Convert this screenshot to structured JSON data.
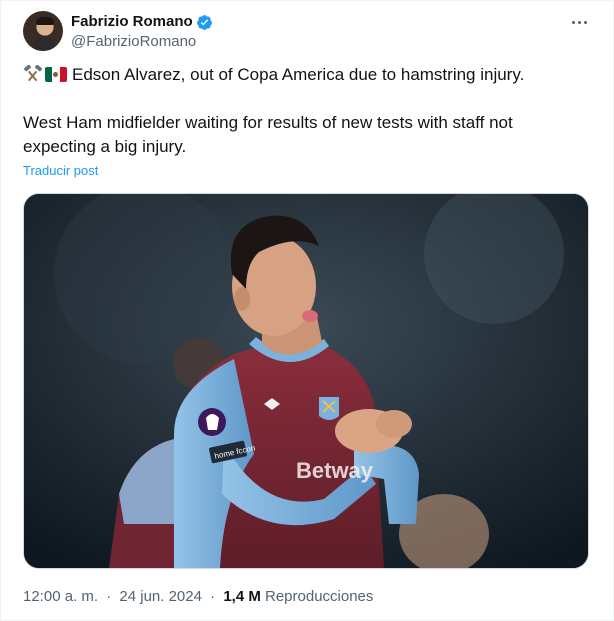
{
  "author": {
    "name": "Fabrizio Romano",
    "handle": "@FabrizioRomano",
    "verified_color": "#1d9bf0"
  },
  "tweet": {
    "line1": "Edson Alvarez, out of Copa America due to hamstring injury.",
    "line2a": "West Ham midfielder waiting for results of new tests with staff not",
    "line2b": "expecting a big injury.",
    "emojis": [
      "hammers-emoji",
      "mexico-flag-emoji"
    ],
    "translate_label": "Traducir post"
  },
  "media": {
    "shirt_sponsor": "Betway",
    "sleeve_patch": "home fccon"
  },
  "meta": {
    "time": "12:00 a. m.",
    "date": "24 jun. 2024",
    "separator": "·",
    "views_count": "1,4 M",
    "views_label": "Reproducciones"
  },
  "colors": {
    "link": "#1d9bf0",
    "muted": "#536471",
    "text": "#0f1419",
    "claret": "#7a2634",
    "sky_blue": "#7bb2dd"
  }
}
